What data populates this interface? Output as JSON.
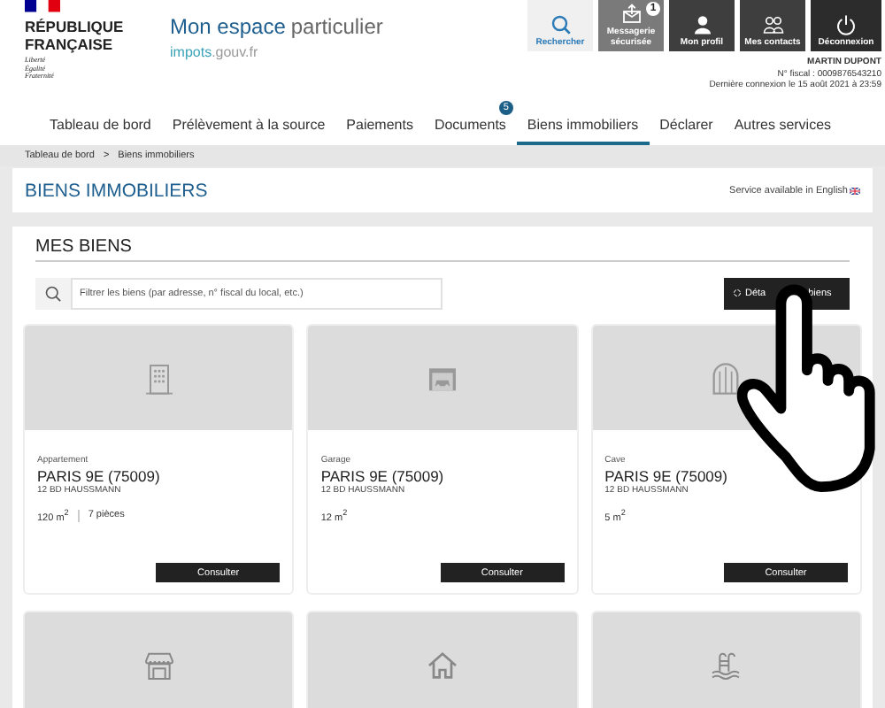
{
  "header": {
    "republic_lines": [
      "RÉPUBLIQUE",
      "FRANÇAISE"
    ],
    "motto": [
      "Liberté",
      "Égalité",
      "Fraternité"
    ],
    "title_main": "Mon espace",
    "title_rest": "particulier",
    "site_main": "impots",
    "site_rest": ".gouv.fr"
  },
  "top_buttons": [
    {
      "kind": "search",
      "label": "Rechercher"
    },
    {
      "kind": "messages",
      "label": "Messagerie sécurisée",
      "badge": "1"
    },
    {
      "kind": "profile",
      "label": "Mon profil"
    },
    {
      "kind": "contacts",
      "label": "Mes contacts"
    },
    {
      "kind": "logout",
      "label": "Déconnexion"
    }
  ],
  "user": {
    "name": "MARTIN DUPONT",
    "fiscal_number": "N° fiscal : 0009876543210",
    "last_login": "Dernière connexion le 15 août 2021 à 23:59"
  },
  "tabs": [
    {
      "label": "Tableau de bord",
      "selected": false
    },
    {
      "label": "Prélèvement à la source",
      "selected": false
    },
    {
      "label": "Paiements",
      "selected": false
    },
    {
      "label": "Documents",
      "selected": false,
      "badge": "5"
    },
    {
      "label": "Biens immobiliers",
      "selected": true
    },
    {
      "label": "Déclarer",
      "selected": false
    },
    {
      "label": "Autres services",
      "selected": false
    }
  ],
  "breadcrumb": {
    "items": [
      "Tableau de bord",
      "Biens immobiliers"
    ],
    "separator": ">"
  },
  "page_title": "BIENS IMMOBILIERS",
  "english_link": "Service available in English",
  "section_title": "MES BIENS",
  "filter": {
    "placeholder": "Filtrer les biens (par adresse, n° fiscal du local, etc.)"
  },
  "details_button": {
    "label_start": "Déta",
    "label_end": "biens"
  },
  "properties": [
    {
      "kind": "apartment",
      "type": "Appartement",
      "city": "PARIS 9E (75009)",
      "address": "12 BD HAUSSMANN",
      "area": "120 m$^{2}$",
      "rooms": "7 pièces",
      "action": "Consulter"
    },
    {
      "kind": "garage",
      "type": "Garage",
      "city": "PARIS 9E (75009)",
      "address": "12 BD HAUSSMANN",
      "area": "12 m$^{2}$",
      "action": "Consulter"
    },
    {
      "kind": "cellar",
      "type": "Cave",
      "city": "PARIS 9E (75009)",
      "address": "12 BD HAUSSMANN",
      "area": "5 m$^{2}$",
      "action": "Consulter"
    },
    {
      "kind": "shop"
    },
    {
      "kind": "house"
    },
    {
      "kind": "pool"
    }
  ]
}
